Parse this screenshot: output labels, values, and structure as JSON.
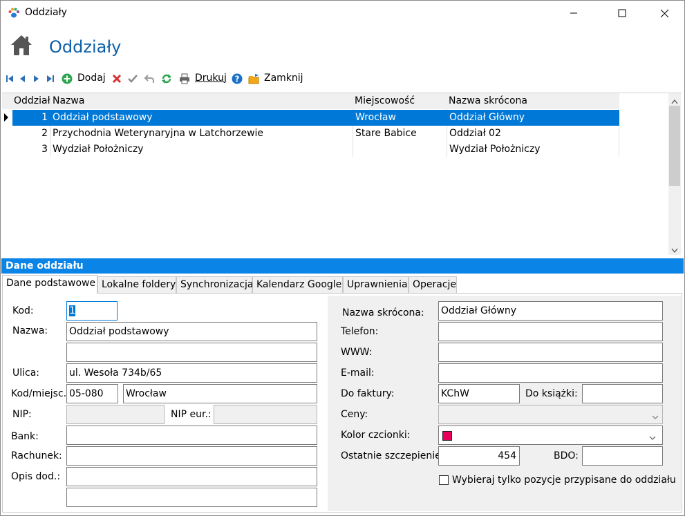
{
  "window": {
    "title": "Oddziały"
  },
  "header": {
    "title": "Oddziały"
  },
  "toolbar": {
    "add_label": "Dodaj",
    "print_label": "Drukuj",
    "close_label": "Zamknij"
  },
  "grid": {
    "columns": [
      "Oddział",
      "Nazwa",
      "Miejscowość",
      "Nazwa skrócona"
    ],
    "rows": [
      {
        "id": "1",
        "name": "Oddział podstawowy",
        "city": "Wrocław",
        "short": "Oddział Główny"
      },
      {
        "id": "2",
        "name": "Przychodnia Weterynaryjna w Latchorzewie",
        "city": "Stare Babice",
        "short": "Oddział 02"
      },
      {
        "id": "3",
        "name": "Wydział Położniczy",
        "city": "",
        "short": "Wydział Położniczy"
      }
    ]
  },
  "panel": {
    "title": "Dane oddziału",
    "tabs": [
      "Dane podstawowe",
      "Lokalne foldery",
      "Synchronizacja",
      "Kalendarz Google",
      "Uprawnienia",
      "Operacje"
    ]
  },
  "form": {
    "labels": {
      "kod": "Kod:",
      "nazwa": "Nazwa:",
      "ulica": "Ulica:",
      "kod_miejsc": "Kod/miejsc.:",
      "nip": "NIP:",
      "nip_eur": "NIP eur.:",
      "bank": "Bank:",
      "rachunek": "Rachunek:",
      "opis": "Opis dod.:",
      "nazwa_skrocona": "Nazwa skrócona:",
      "telefon": "Telefon:",
      "www": "WWW:",
      "email": "E-mail:",
      "do_faktury": "Do faktury:",
      "do_ksiazki": "Do książki:",
      "ceny": "Ceny:",
      "kolor": "Kolor czcionki:",
      "szczepienie": "Ostatnie szczepienie:",
      "bdo": "BDO:"
    },
    "values": {
      "kod": "1",
      "nazwa": "Oddział podstawowy",
      "nazwa2": "",
      "ulica": "ul. Wesoła 734b/65",
      "kod_pocztowy": "05-080",
      "miejscowosc": "Wrocław",
      "nip": "",
      "nip_eur": "",
      "bank": "",
      "rachunek": "",
      "opis1": "",
      "opis2": "",
      "nazwa_skrocona": "Oddział Główny",
      "telefon": "",
      "www": "",
      "email": "",
      "do_faktury": "KChW",
      "do_ksiazki": "",
      "ceny": "",
      "szczepienie": "454",
      "bdo": ""
    },
    "checkbox_label": "Wybieraj tylko pozycje przypisane do oddziału",
    "checkbox_checked": false,
    "font_color": "#e8005a"
  },
  "colors": {
    "accent": "#0078d7",
    "panel_header": "#0a84e6",
    "title": "#0e5fa8"
  }
}
